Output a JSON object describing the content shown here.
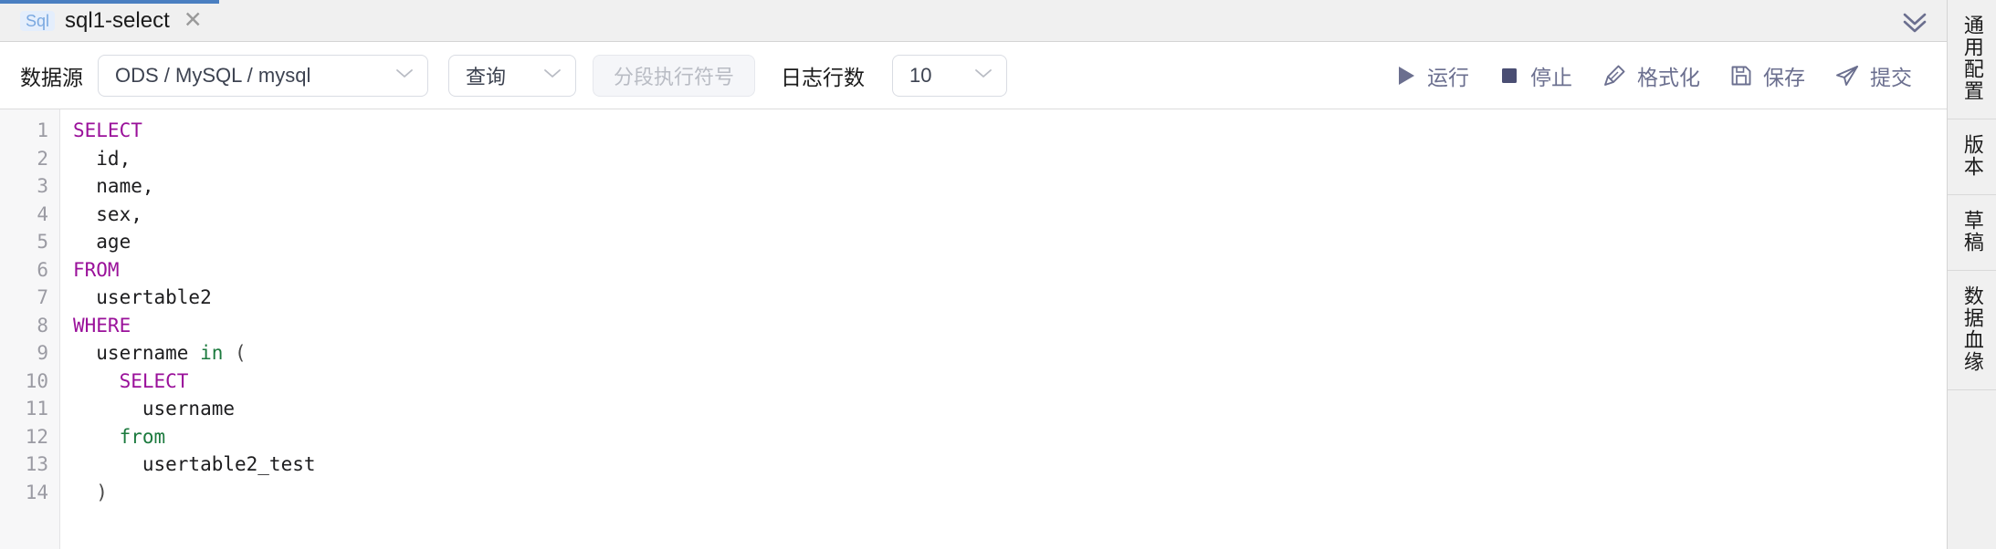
{
  "tab": {
    "badge": "Sql",
    "title": "sql1-select",
    "close_icon": "close-icon",
    "collapse_icon": "double-chevron-down-icon"
  },
  "toolbar": {
    "datasource_label": "数据源",
    "datasource_value": "ODS / MySQL / mysql",
    "mode_value": "查询",
    "segment_exec_label": "分段执行符号",
    "log_rows_label": "日志行数",
    "log_rows_value": "10",
    "actions": [
      {
        "label": "运行",
        "icon": "play-icon"
      },
      {
        "label": "停止",
        "icon": "stop-square-icon"
      },
      {
        "label": "格式化",
        "icon": "brush-icon"
      },
      {
        "label": "保存",
        "icon": "floppy-disk-icon"
      },
      {
        "label": "提交",
        "icon": "paper-plane-icon"
      }
    ]
  },
  "editor": {
    "line_numbers": [
      "1",
      "2",
      "3",
      "4",
      "5",
      "6",
      "7",
      "8",
      "9",
      "10",
      "11",
      "12",
      "13",
      "14"
    ],
    "lines": [
      {
        "tokens": [
          {
            "t": "SELECT",
            "c": "kw"
          }
        ]
      },
      {
        "tokens": [
          {
            "t": "  id,",
            "c": ""
          }
        ]
      },
      {
        "tokens": [
          {
            "t": "  name,",
            "c": ""
          }
        ]
      },
      {
        "tokens": [
          {
            "t": "  sex,",
            "c": ""
          }
        ]
      },
      {
        "tokens": [
          {
            "t": "  age",
            "c": ""
          }
        ]
      },
      {
        "tokens": [
          {
            "t": "FROM",
            "c": "kw"
          }
        ]
      },
      {
        "tokens": [
          {
            "t": "  usertable2",
            "c": ""
          }
        ]
      },
      {
        "tokens": [
          {
            "t": "WHERE",
            "c": "kw"
          }
        ]
      },
      {
        "tokens": [
          {
            "t": "  username ",
            "c": ""
          },
          {
            "t": "in",
            "c": "kw2"
          },
          {
            "t": " ",
            "c": ""
          },
          {
            "t": "(",
            "c": "pn"
          }
        ]
      },
      {
        "tokens": [
          {
            "t": "    SELECT",
            "c": "kw"
          }
        ]
      },
      {
        "tokens": [
          {
            "t": "      username",
            "c": ""
          }
        ]
      },
      {
        "tokens": [
          {
            "t": "    ",
            "c": ""
          },
          {
            "t": "from",
            "c": "kw2"
          }
        ]
      },
      {
        "tokens": [
          {
            "t": "      usertable2_test",
            "c": ""
          }
        ]
      },
      {
        "tokens": [
          {
            "t": "  ",
            "c": ""
          },
          {
            "t": ")",
            "c": "pn"
          }
        ]
      }
    ]
  },
  "rail": {
    "items": [
      {
        "label": "通用配置"
      },
      {
        "label": "版本"
      },
      {
        "label": "草稿"
      },
      {
        "label": "数据血缘"
      }
    ]
  },
  "colors": {
    "accent": "#4a7fc1",
    "action": "#6b6f8f",
    "keyword": "#9a109a",
    "keyword2": "#1c7a3e"
  }
}
